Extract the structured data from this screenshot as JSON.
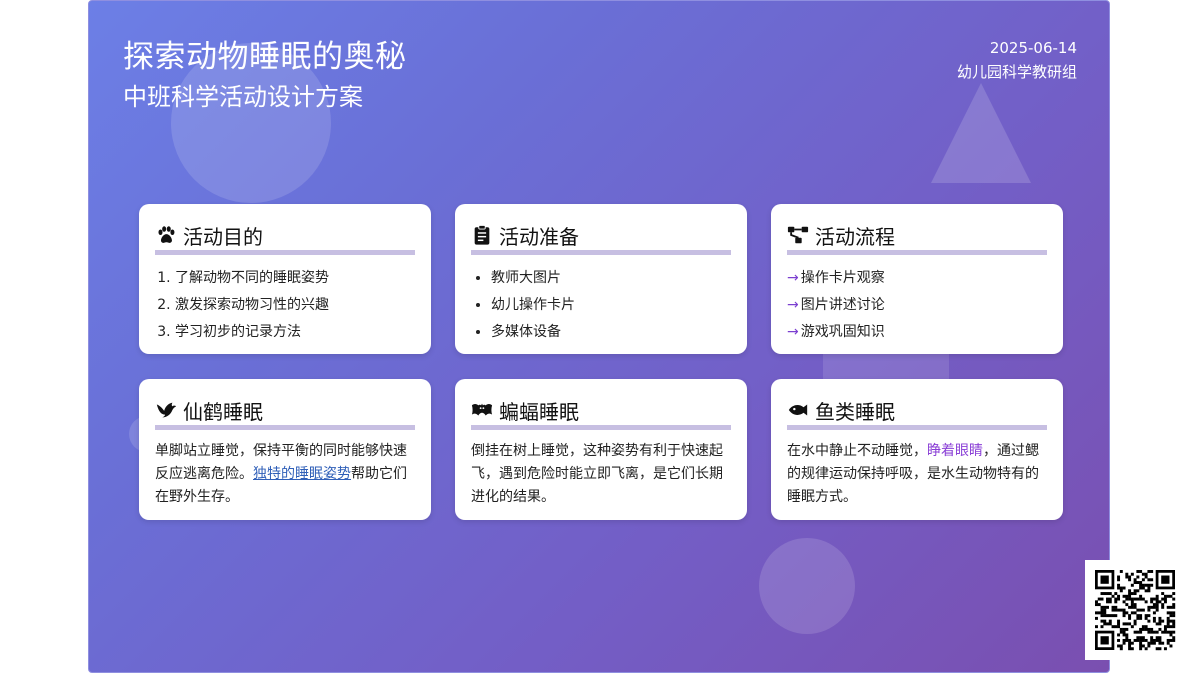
{
  "header": {
    "title": "探索动物睡眠的奥秘",
    "subtitle": "中班科学活动设计方案",
    "date": "2025-06-14",
    "author": "幼儿园科学教研组"
  },
  "cards": [
    {
      "title": "活动目的",
      "icon": "paw-icon",
      "items": [
        "了解动物不同的睡眠姿势",
        "激发探索动物习性的兴趣",
        "学习初步的记录方法"
      ]
    },
    {
      "title": "活动准备",
      "icon": "clipboard-icon",
      "items": [
        "教师大图片",
        "幼儿操作卡片",
        "多媒体设备"
      ]
    },
    {
      "title": "活动流程",
      "icon": "flow-icon",
      "items": [
        "操作卡片观察",
        "图片讲述讨论",
        "游戏巩固知识"
      ]
    },
    {
      "title": "仙鹤睡眠",
      "icon": "bird-icon",
      "text_before": "单脚站立睡觉，保持平衡的同时能够快速反应逃离危险。",
      "link": "独特的睡眠姿势",
      "text_after": "帮助它们在野外生存。"
    },
    {
      "title": "蝙蝠睡眠",
      "icon": "bat-icon",
      "text": "倒挂在树上睡觉，这种姿势有利于快速起飞，遇到危险时能立即飞离，是它们长期进化的结果。"
    },
    {
      "title": "鱼类睡眠",
      "icon": "fish-icon",
      "text_before": "在水中静止不动睡觉，",
      "highlight": "睁着眼睛",
      "text_after": "，通过鳃的规律运动保持呼吸，是水生动物特有的睡眠方式。"
    }
  ],
  "theme": {
    "accent": "#7b3fd0",
    "link": "#2f5fb8",
    "underline": "#c7bfe2"
  },
  "qr_icon": "qr-code-icon"
}
